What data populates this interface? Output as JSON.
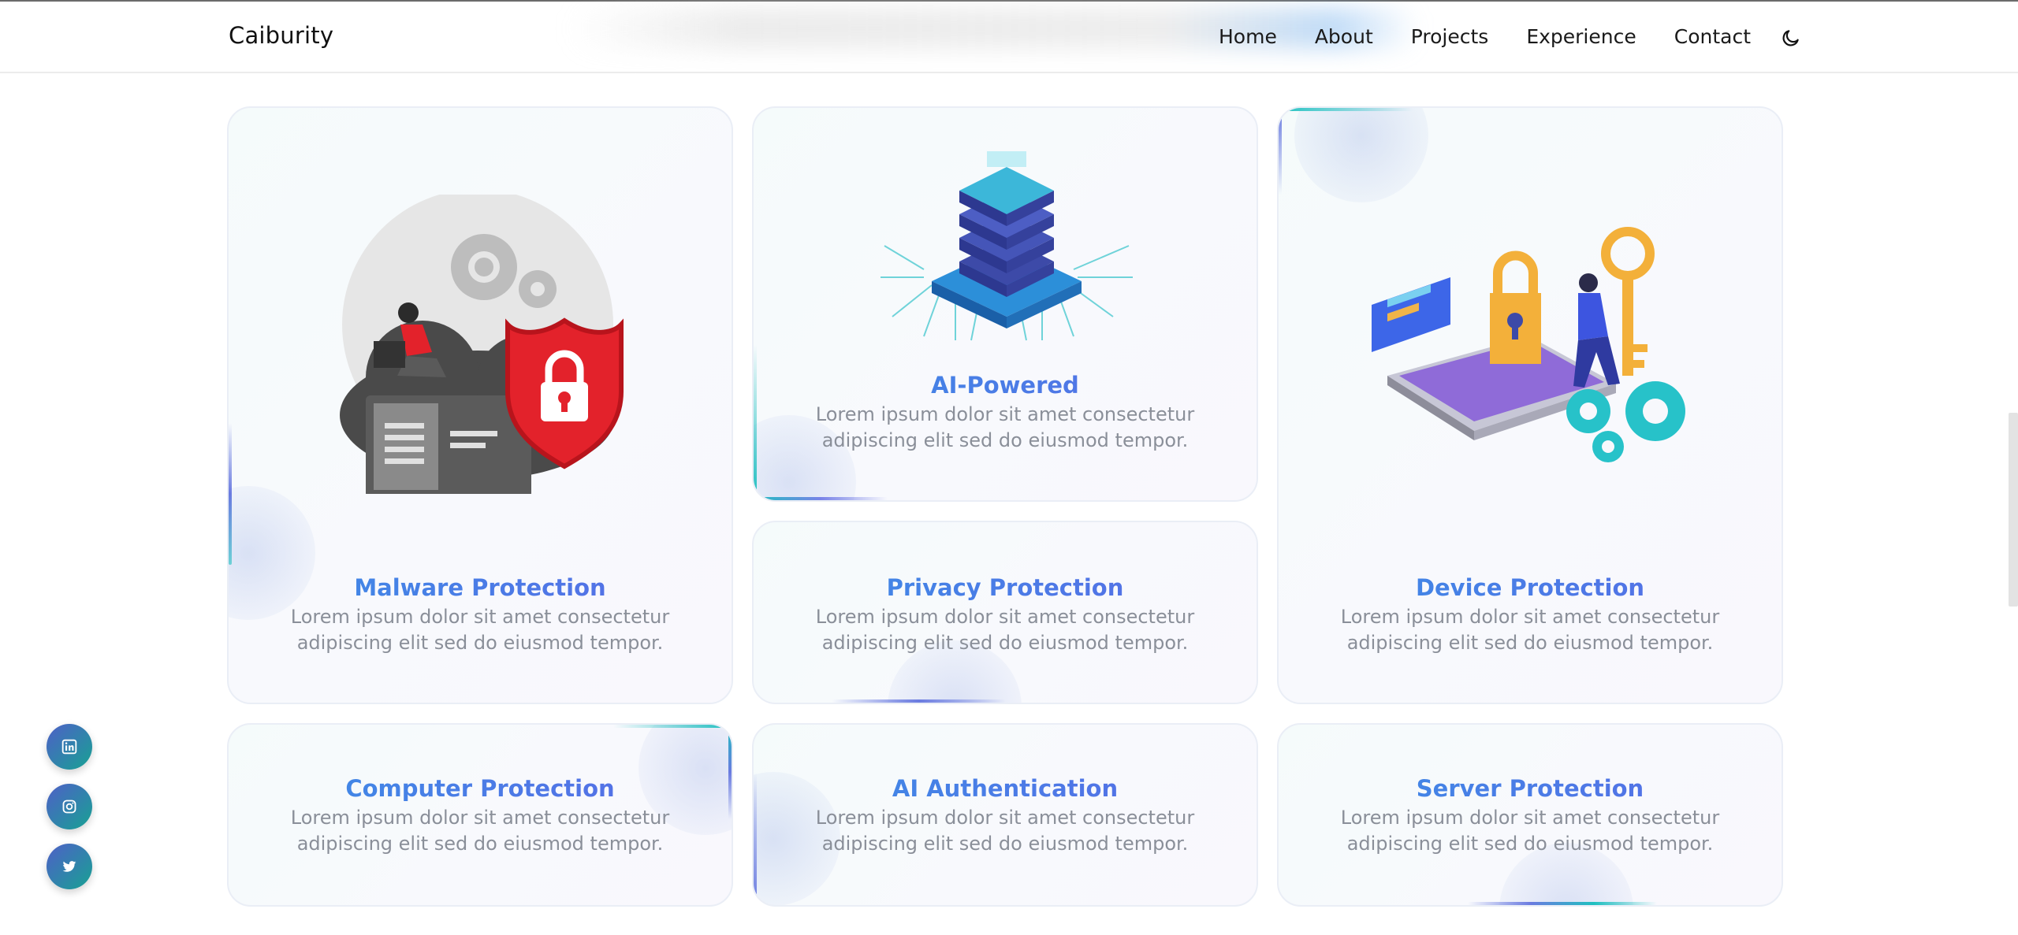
{
  "brand": "Caiburity",
  "nav": {
    "links": [
      "Home",
      "About",
      "Projects",
      "Experience",
      "Contact"
    ],
    "theme_icon": "moon-icon"
  },
  "colors": {
    "title_gradient_start": "#3b8ee6",
    "title_gradient_end": "#5a6ae6",
    "description": "#8a8f99",
    "social_gradient_start": "#4f5fc8",
    "social_gradient_end": "#17a293"
  },
  "cards": [
    {
      "title": "Malware Protection",
      "description": "Lorem ipsum dolor sit amet consectetur adipiscing elit sed do eiusmod tempor.",
      "illustration": "cloud-shield-lock-illustration"
    },
    {
      "title": "AI-Powered",
      "description": "Lorem ipsum dolor sit amet consectetur adipiscing elit sed do eiusmod tempor.",
      "illustration": "ai-chip-illustration"
    },
    {
      "title": "Device Protection",
      "description": "Lorem ipsum dolor sit amet consectetur adipiscing elit sed do eiusmod tempor.",
      "illustration": "phone-lock-key-illustration"
    },
    {
      "title": "Privacy Protection",
      "description": "Lorem ipsum dolor sit amet consectetur adipiscing elit sed do eiusmod tempor."
    },
    {
      "title": "Computer Protection",
      "description": "Lorem ipsum dolor sit amet consectetur adipiscing elit sed do eiusmod tempor."
    },
    {
      "title": "AI Authentication",
      "description": "Lorem ipsum dolor sit amet consectetur adipiscing elit sed do eiusmod tempor."
    },
    {
      "title": "Server Protection",
      "description": "Lorem ipsum dolor sit amet consectetur adipiscing elit sed do eiusmod tempor."
    }
  ],
  "social": [
    {
      "icon": "linkedin-icon"
    },
    {
      "icon": "instagram-icon"
    },
    {
      "icon": "twitter-icon"
    }
  ]
}
